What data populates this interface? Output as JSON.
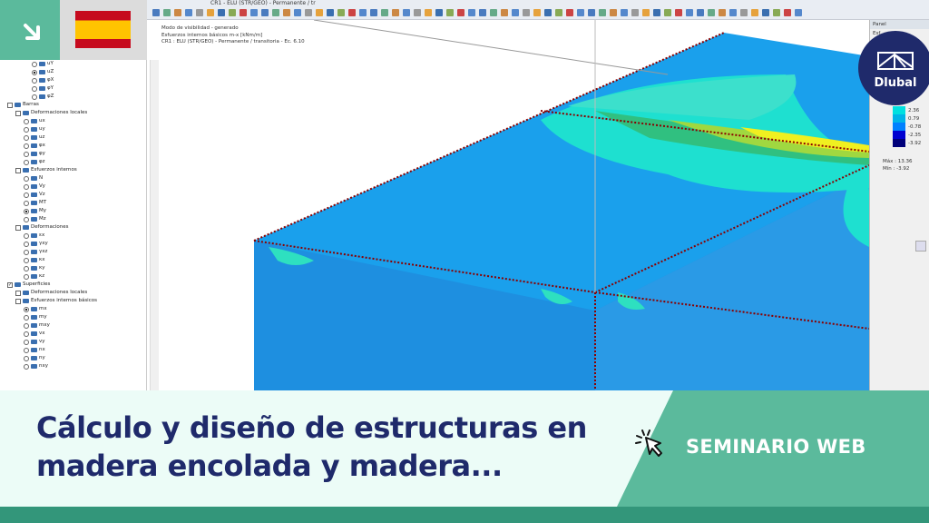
{
  "window_title": "CR1 - ELU (STR/GEO) - Permanente / tr",
  "view_info": [
    "Modo de visibilidad - generado",
    "Esfuerzos internos básicos m-x [kNm/m]",
    "CR1 : ELU (STR/GEO) - Permanente / transitoria - Ec. 6.10"
  ],
  "tree": [
    {
      "label": "uY",
      "level": 3,
      "type": "radio",
      "on": false
    },
    {
      "label": "uZ",
      "level": 3,
      "type": "radio",
      "on": true
    },
    {
      "label": "φX",
      "level": 3,
      "type": "radio",
      "on": false
    },
    {
      "label": "φY",
      "level": 3,
      "type": "radio",
      "on": false
    },
    {
      "label": "φZ",
      "level": 3,
      "type": "radio",
      "on": false
    },
    {
      "label": "Barras",
      "level": 0,
      "type": "check",
      "on": false
    },
    {
      "label": "Deformaciones locales",
      "level": 1,
      "type": "check",
      "on": false
    },
    {
      "label": "ux",
      "level": 2,
      "type": "radio",
      "on": false
    },
    {
      "label": "uy",
      "level": 2,
      "type": "radio",
      "on": false
    },
    {
      "label": "uz",
      "level": 2,
      "type": "radio",
      "on": false
    },
    {
      "label": "φx",
      "level": 2,
      "type": "radio",
      "on": false
    },
    {
      "label": "φy",
      "level": 2,
      "type": "radio",
      "on": false
    },
    {
      "label": "φz",
      "level": 2,
      "type": "radio",
      "on": false
    },
    {
      "label": "Esfuerzos internos",
      "level": 1,
      "type": "check",
      "on": false
    },
    {
      "label": "N",
      "level": 2,
      "type": "radio",
      "on": false
    },
    {
      "label": "Vy",
      "level": 2,
      "type": "radio",
      "on": false
    },
    {
      "label": "Vz",
      "level": 2,
      "type": "radio",
      "on": false
    },
    {
      "label": "MT",
      "level": 2,
      "type": "radio",
      "on": false
    },
    {
      "label": "My",
      "level": 2,
      "type": "radio",
      "on": true
    },
    {
      "label": "Mz",
      "level": 2,
      "type": "radio",
      "on": false
    },
    {
      "label": "Deformaciones",
      "level": 1,
      "type": "check",
      "on": false
    },
    {
      "label": "εx",
      "level": 2,
      "type": "radio",
      "on": false
    },
    {
      "label": "γxy",
      "level": 2,
      "type": "radio",
      "on": false
    },
    {
      "label": "γxz",
      "level": 2,
      "type": "radio",
      "on": false
    },
    {
      "label": "κx",
      "level": 2,
      "type": "radio",
      "on": false
    },
    {
      "label": "κy",
      "level": 2,
      "type": "radio",
      "on": false
    },
    {
      "label": "κz",
      "level": 2,
      "type": "radio",
      "on": false
    },
    {
      "label": "Superficies",
      "level": 0,
      "type": "check",
      "on": true
    },
    {
      "label": "Deformaciones locales",
      "level": 1,
      "type": "check",
      "on": false
    },
    {
      "label": "Esfuerzos internos básicos",
      "level": 1,
      "type": "check",
      "on": false
    },
    {
      "label": "mx",
      "level": 2,
      "type": "radio",
      "on": true
    },
    {
      "label": "my",
      "level": 2,
      "type": "radio",
      "on": false
    },
    {
      "label": "mxy",
      "level": 2,
      "type": "radio",
      "on": false
    },
    {
      "label": "vx",
      "level": 2,
      "type": "radio",
      "on": false
    },
    {
      "label": "vy",
      "level": 2,
      "type": "radio",
      "on": false
    },
    {
      "label": "nx",
      "level": 2,
      "type": "radio",
      "on": false
    },
    {
      "label": "ny",
      "level": 2,
      "type": "radio",
      "on": false
    },
    {
      "label": "nxy",
      "level": 2,
      "type": "radio",
      "on": false
    }
  ],
  "panel": {
    "title": "Panel",
    "subtitle": "Esf...",
    "legend": [
      {
        "value": "2.36",
        "color": "#00e0e0"
      },
      {
        "value": "0.79",
        "color": "#00b4e8"
      },
      {
        "value": "-0.78",
        "color": "#0080ff"
      },
      {
        "value": "-2.35",
        "color": "#0000d0"
      },
      {
        "value": "-3.92",
        "color": "#00007a"
      }
    ],
    "max_label": "Máx :",
    "max": "13.36",
    "min_label": "Mín :",
    "min": "-3.92"
  },
  "logo": "Dlubal",
  "banner": {
    "title": "Cálculo y diseño de estructuras en madera encolada y madera...",
    "tag": "SEMINARIO WEB"
  },
  "colors": {
    "brand_green": "#5bba9c",
    "navy": "#1f2a6b"
  }
}
